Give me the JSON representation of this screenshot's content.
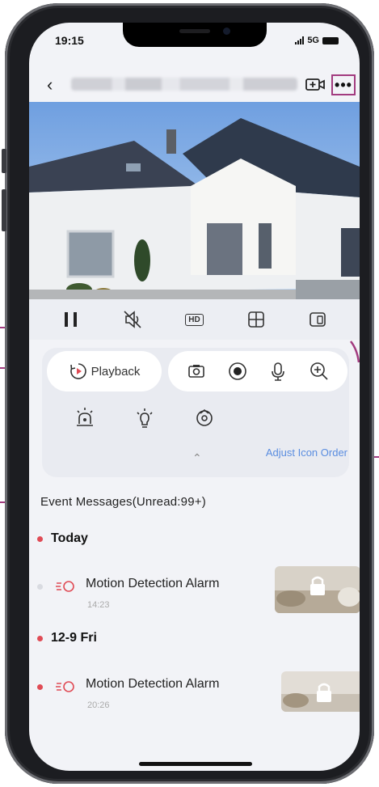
{
  "status_bar": {
    "time": "19:15",
    "network": "5G"
  },
  "nav": {
    "back_icon": "chevron-left-icon",
    "title": "",
    "add_camera_icon": "add-camera-icon",
    "more_label": "•••"
  },
  "video": {
    "scene": "house-camera-feed"
  },
  "controls": [
    {
      "name": "pause-icon"
    },
    {
      "name": "mute-icon"
    },
    {
      "name": "hd-icon",
      "label": "HD"
    },
    {
      "name": "multiview-icon"
    },
    {
      "name": "orientation-icon"
    }
  ],
  "actions": {
    "playback_label": "Playback",
    "tools": [
      "screenshot-icon",
      "record-icon",
      "microphone-icon",
      "zoom-icon"
    ],
    "row2": [
      "siren-icon",
      "light-icon",
      "ptz-icon"
    ],
    "adjust_label": "Adjust Icon Order"
  },
  "events": {
    "header": "Event Messages(Unread:99+)",
    "groups": [
      {
        "day": "Today",
        "items": [
          {
            "title": "Motion Detection Alarm",
            "time": "14:23",
            "unread": false
          }
        ]
      },
      {
        "day": "12-9 Fri",
        "items": [
          {
            "title": "Motion Detection Alarm",
            "time": "20:26",
            "unread": true
          }
        ]
      }
    ]
  },
  "colors": {
    "accent": "#5a8de0",
    "unread": "#e04b55",
    "callout": "#a23b7f"
  }
}
